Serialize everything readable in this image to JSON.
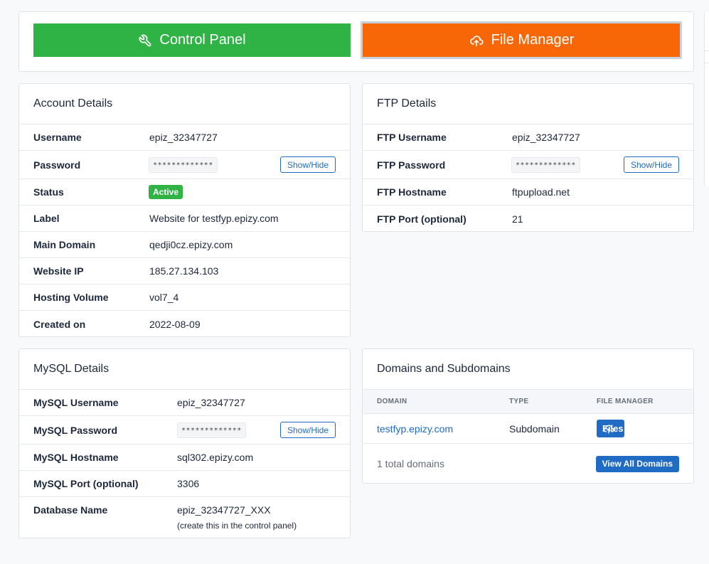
{
  "top": {
    "control_panel_label": "Control Panel",
    "file_manager_label": "File Manager"
  },
  "account": {
    "title": "Account Details",
    "show_hide": "Show/Hide",
    "rows": [
      {
        "label": "Username",
        "value": "epiz_32347727"
      },
      {
        "label": "Password",
        "value": "*************"
      },
      {
        "label": "Status",
        "value": "Active"
      },
      {
        "label": "Label",
        "value": "Website for testfyp.epizy.com"
      },
      {
        "label": "Main Domain",
        "value": "qedji0cz.epizy.com"
      },
      {
        "label": "Website IP",
        "value": "185.27.134.103"
      },
      {
        "label": "Hosting Volume",
        "value": "vol7_4"
      },
      {
        "label": "Created on",
        "value": "2022-08-09"
      }
    ]
  },
  "ftp": {
    "title": "FTP Details",
    "show_hide": "Show/Hide",
    "rows": [
      {
        "label": "FTP Username",
        "value": "epiz_32347727"
      },
      {
        "label": "FTP Password",
        "value": "*************"
      },
      {
        "label": "FTP Hostname",
        "value": "ftpupload.net"
      },
      {
        "label": "FTP Port (optional)",
        "value": "21"
      }
    ]
  },
  "mysql": {
    "title": "MySQL Details",
    "show_hide": "Show/Hide",
    "rows": [
      {
        "label": "MySQL Username",
        "value": "epiz_32347727"
      },
      {
        "label": "MySQL Password",
        "value": "*************"
      },
      {
        "label": "MySQL Hostname",
        "value": "sql302.epizy.com"
      },
      {
        "label": "MySQL Port (optional)",
        "value": "3306"
      },
      {
        "label": "Database Name",
        "value": "epiz_32347727_XXX",
        "note": "(create this in the control panel)"
      }
    ]
  },
  "domains": {
    "title": "Domains and Subdomains",
    "headers": [
      "DOMAIN",
      "TYPE",
      "FILE MANAGER"
    ],
    "rows": [
      {
        "domain": "testfyp.epizy.com",
        "type": "Subdomain",
        "action": "Files"
      }
    ],
    "total": "1 total domains",
    "view_all": "View All Domains"
  },
  "colors": {
    "green": "#2fb344",
    "orange": "#f76707",
    "blue": "#206bc4"
  },
  "icons": {
    "control_panel": "wrench-icon",
    "file_manager": "cloud-upload-icon",
    "files": "cloud-upload-icon"
  }
}
